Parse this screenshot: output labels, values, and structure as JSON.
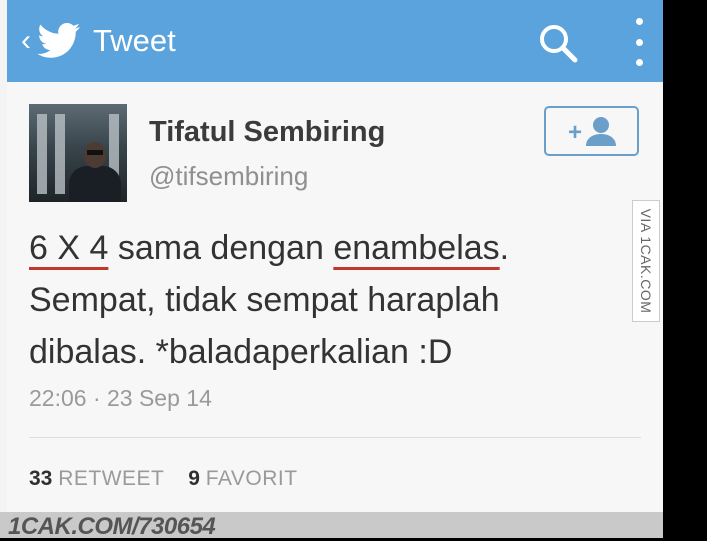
{
  "header": {
    "back_glyph": "‹",
    "title": "Tweet",
    "icons": [
      "twitter-bird-icon",
      "search-icon",
      "overflow-menu-icon"
    ],
    "color": "#5aa3dc"
  },
  "tweet": {
    "author_name": "Tifatul Sembiring",
    "handle": "@tifsembiring",
    "follow_label": "+",
    "text_part1": "6 X 4",
    "text_part2": " sama dengan ",
    "text_part3": "enambelas",
    "text_part4": ". Sempat, tidak sempat haraplah dibalas. *baladaperkalian :D",
    "time": "22:06 · 23 Sep 14",
    "retweets": "33",
    "retweet_label": "RETWEET",
    "favorites": "9",
    "favorite_label": "FAVORIT"
  },
  "watermark": {
    "side": "VIA 1CAK.COM",
    "footer": "1CAK.COM/730654"
  }
}
